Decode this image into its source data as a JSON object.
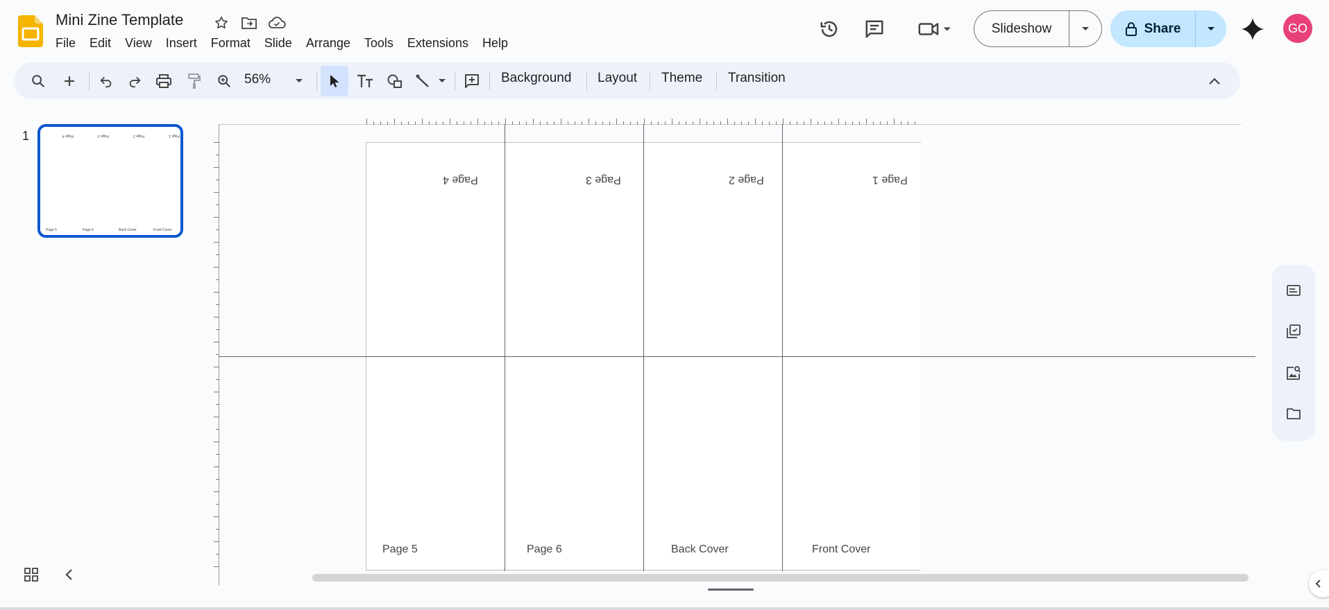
{
  "doc": {
    "title": "Mini Zine Template"
  },
  "menu": [
    "File",
    "Edit",
    "View",
    "Insert",
    "Format",
    "Slide",
    "Arrange",
    "Tools",
    "Extensions",
    "Help"
  ],
  "header": {
    "slideshow_label": "Slideshow",
    "share_label": "Share",
    "avatar_initials": "GO"
  },
  "toolbar": {
    "zoom": "56%",
    "background": "Background",
    "layout": "Layout",
    "theme": "Theme",
    "transition": "Transition"
  },
  "filmstrip": {
    "slide_number": "1",
    "thumb_top": [
      "Page 4",
      "Page 3",
      "Page 2",
      "Page 1"
    ],
    "thumb_bottom": [
      "Page 5",
      "Page 6",
      "Back Cover",
      "Front Cover"
    ]
  },
  "slide": {
    "top_pages": [
      "Page 4",
      "Page 3",
      "Page 2",
      "Page 1"
    ],
    "bottom_pages": [
      "Page 5",
      "Page 6",
      "Back Cover",
      "Front Cover"
    ]
  },
  "colors": {
    "accent": "#0b57d0",
    "share_bg": "#c2e7ff",
    "avatar": "#e8417a",
    "logo": "#f4b400"
  }
}
